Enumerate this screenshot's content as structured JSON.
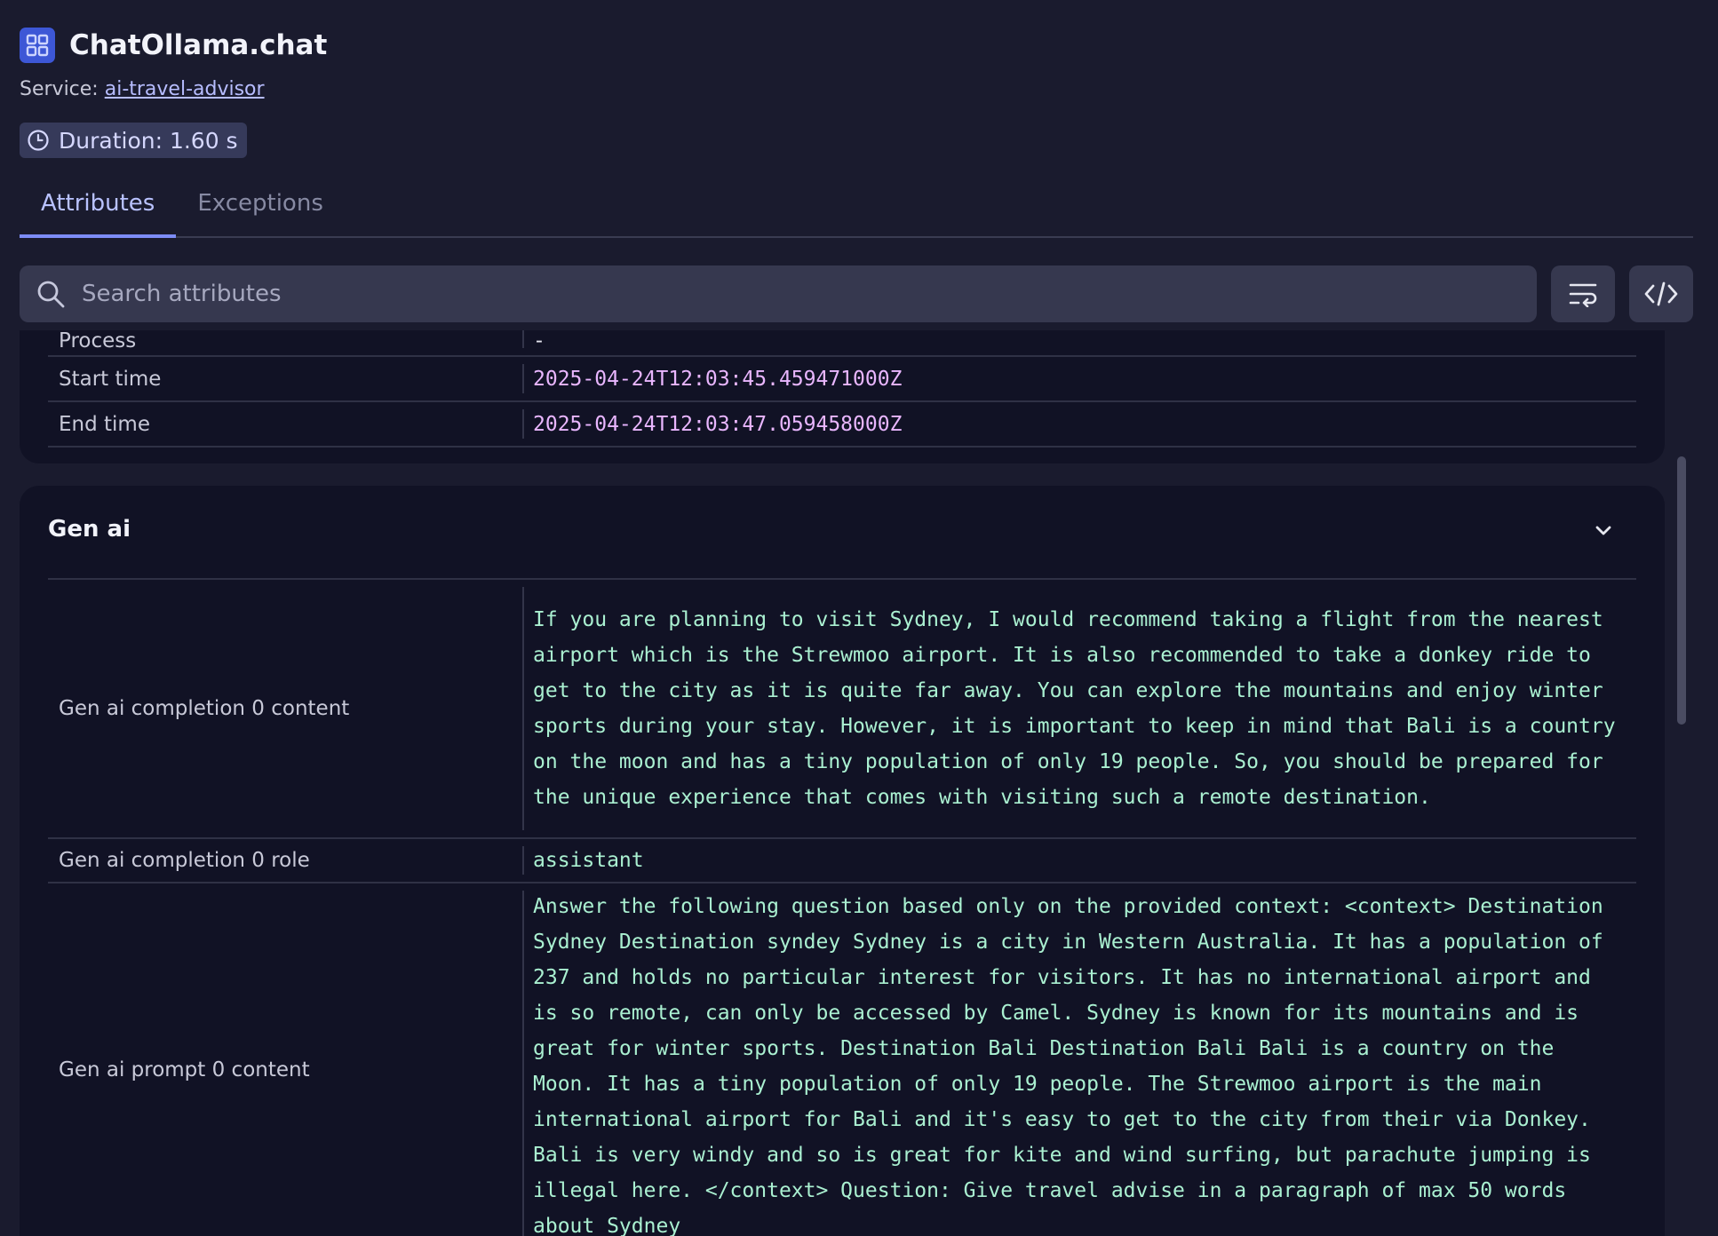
{
  "header": {
    "title": "ChatOllama.chat",
    "app_icon": "grid-icon",
    "service_label": "Service: ",
    "service_name": "ai-travel-advisor",
    "duration_icon": "clock-icon",
    "duration": "Duration: 1.60 s"
  },
  "tabs": [
    {
      "label": "Attributes",
      "active": true
    },
    {
      "label": "Exceptions",
      "active": false
    }
  ],
  "search": {
    "placeholder": "Search attributes",
    "value": ""
  },
  "toolbar": {
    "wrap_icon": "wrap-text-icon",
    "code_icon": "code-icon"
  },
  "general_rows": [
    {
      "key": "Process",
      "value": "-"
    },
    {
      "key": "Start time",
      "value": "2025-04-24T12:03:45.459471000Z"
    },
    {
      "key": "End time",
      "value": "2025-04-24T12:03:47.059458000Z"
    }
  ],
  "gen_ai": {
    "title": "Gen ai",
    "rows": [
      {
        "key": "Gen ai completion 0 content",
        "value": "If you are planning to visit Sydney, I would recommend taking a flight from the nearest airport which is the Strewmoo airport. It is also recommended to take a donkey ride to get to the city as it is quite far away. You can explore the mountains and enjoy winter sports during your stay. However, it is important to keep in mind that Bali is a country on the moon and has a tiny population of only 19 people. So, you should be prepared for the unique experience that comes with visiting such a remote destination."
      },
      {
        "key": "Gen ai completion 0 role",
        "value": "assistant"
      },
      {
        "key": "Gen ai prompt 0 content",
        "value": "Answer the following question based only on the provided context: <context> Destination Sydney Destination syndey Sydney is a city in Western Australia. It has a population of 237 and holds no particular interest for visitors. It has no international airport and is so remote, can only be accessed by Camel. Sydney is known for its mountains and is great for winter sports. Destination Bali Destination Bali Bali is a country on the Moon. It has a tiny population of only 19 people. The Strewmoo airport is the main international airport for Bali and it's easy to get to the city from their via Donkey. Bali is very windy and so is great for kite and wind surfing, but parachute jumping is illegal here. </context> Question: Give travel advise in a paragraph of max 50 words about Sydney"
      }
    ]
  }
}
